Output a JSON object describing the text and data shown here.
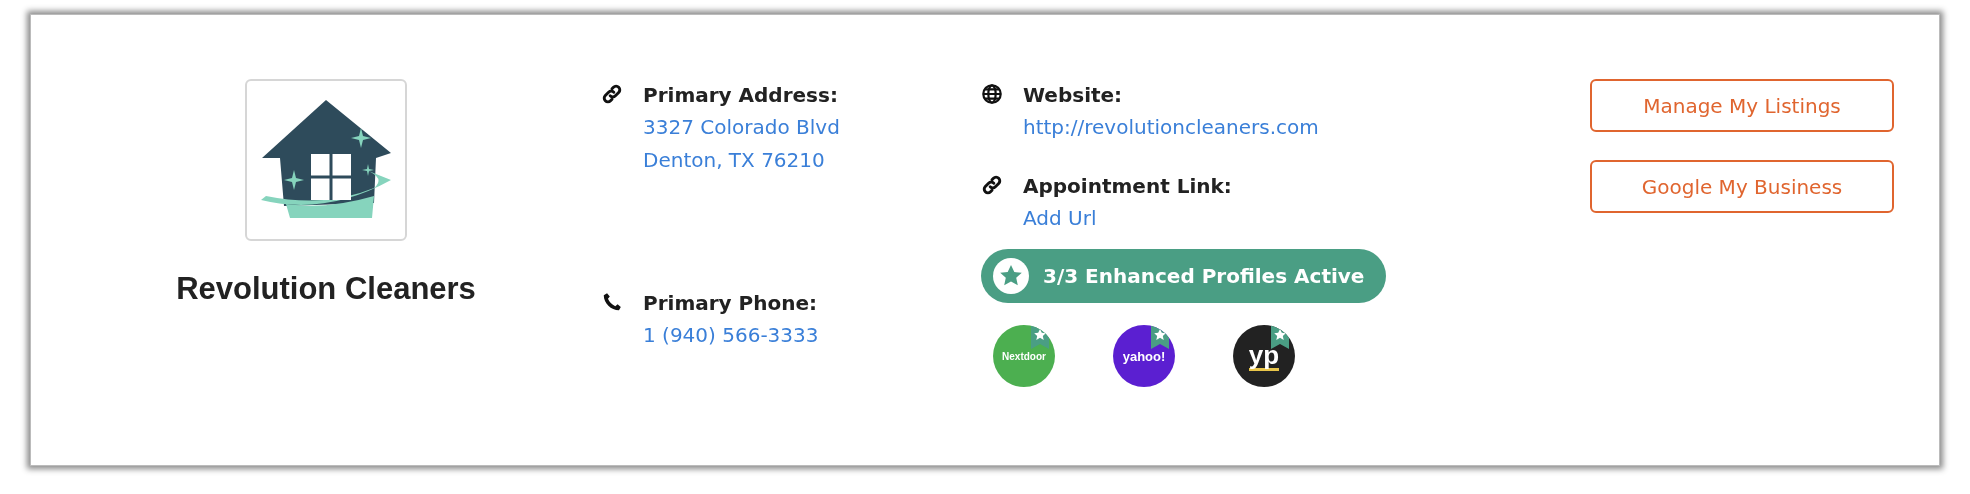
{
  "business": {
    "name": "Revolution Cleaners"
  },
  "address": {
    "label": "Primary Address:",
    "lines": [
      "3327 Colorado Blvd",
      "Denton, TX 76210"
    ]
  },
  "phone": {
    "label": "Primary Phone:",
    "value": "1 (940) 566-3333"
  },
  "website": {
    "label": "Website:",
    "value": "http://revolutioncleaners.com"
  },
  "appointment": {
    "label": "Appointment Link:",
    "value": "Add Url"
  },
  "enhanced_badge": {
    "text": "3/3 Enhanced Profiles Active"
  },
  "profiles": [
    {
      "name": "Nextdoor",
      "color": "#4caf50",
      "kind": "nextdoor"
    },
    {
      "name": "yahoo!",
      "color": "#5b1fd1",
      "kind": "yahoo"
    },
    {
      "name": "yp",
      "color": "#222222",
      "kind": "yp"
    }
  ],
  "buttons": [
    "Manage My Listings",
    "Google My Business"
  ]
}
